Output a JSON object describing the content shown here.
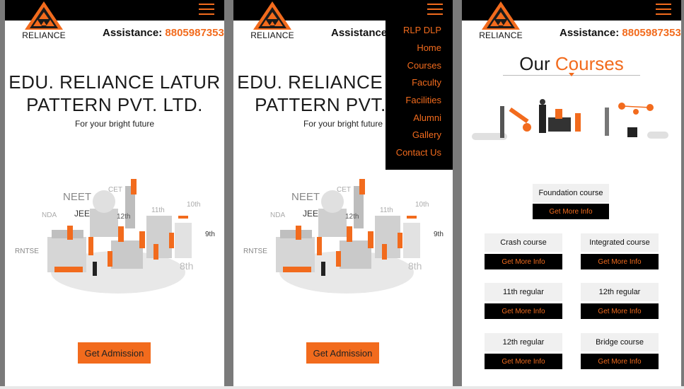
{
  "brand": {
    "logo_text": "RELIANCE"
  },
  "assistance": {
    "label": "Assistance:",
    "phone": "8805987353"
  },
  "hero": {
    "title_line1": "EDU. RELIANCE LATUR",
    "title_line2": "PATTERN PVT. LTD.",
    "subtitle": "For your bright future",
    "exam_labels": [
      "NEET",
      "JEE",
      "CET",
      "NDA",
      "RNTSE",
      "12th",
      "11th",
      "10th",
      "9th",
      "8th"
    ]
  },
  "cta": {
    "admission_label": "Get Admission"
  },
  "menu": {
    "items": [
      "RLP DLP",
      "Home",
      "Courses",
      "Faculty",
      "Facilities",
      "Alumni",
      "Gallery",
      "Contact Us"
    ]
  },
  "courses": {
    "title_part1": "Our",
    "title_part2": "Courses",
    "button_label": "Get More Info",
    "items": [
      {
        "name": "Foundation course"
      },
      {
        "name": "Crash course"
      },
      {
        "name": "Integrated course"
      },
      {
        "name": "11th regular"
      },
      {
        "name": "12th regular"
      },
      {
        "name": "12th regular"
      },
      {
        "name": "Bridge course"
      }
    ]
  },
  "colors": {
    "accent": "#f26b1d",
    "bar": "#000000",
    "background": "#7a7a7a"
  }
}
